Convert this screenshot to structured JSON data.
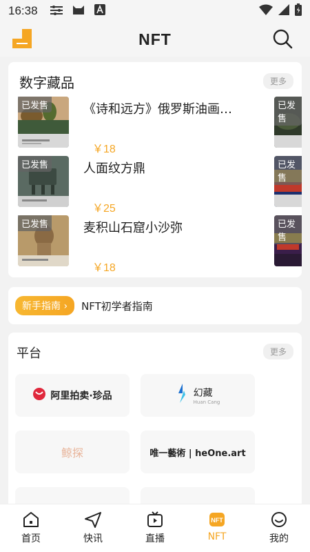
{
  "status": {
    "time": "16:38"
  },
  "header": {
    "title": "NFT"
  },
  "collectibles": {
    "title": "数字藏品",
    "more_label": "更多",
    "items": [
      {
        "tag": "已发售",
        "name": "《诗和远方》俄罗斯油画…",
        "price": "￥18"
      },
      {
        "tag": "已发售",
        "name": "人面纹方鼎",
        "price": "￥25"
      },
      {
        "tag": "已发售",
        "name": "麦积山石窟小沙弥",
        "price": "￥18"
      }
    ],
    "side_tags": [
      "已发售",
      "已发售",
      "已发售"
    ]
  },
  "guide": {
    "badge": "新手指南",
    "badge_arrow": "›",
    "text": "NFT初学者指南"
  },
  "platforms": {
    "title": "平台",
    "more_label": "更多",
    "items": [
      {
        "name": "阿里拍卖·珍品"
      },
      {
        "name": "幻藏",
        "sub": "Huan Cang"
      },
      {
        "name": "鲸探"
      },
      {
        "name": "唯一藝術 | heOne.art"
      }
    ]
  },
  "tabs": [
    {
      "label": "首页"
    },
    {
      "label": "快讯"
    },
    {
      "label": "直播"
    },
    {
      "label": "NFT"
    },
    {
      "label": "我的"
    }
  ],
  "colors": {
    "accent": "#f5a623",
    "background": "#f2f2f2"
  }
}
